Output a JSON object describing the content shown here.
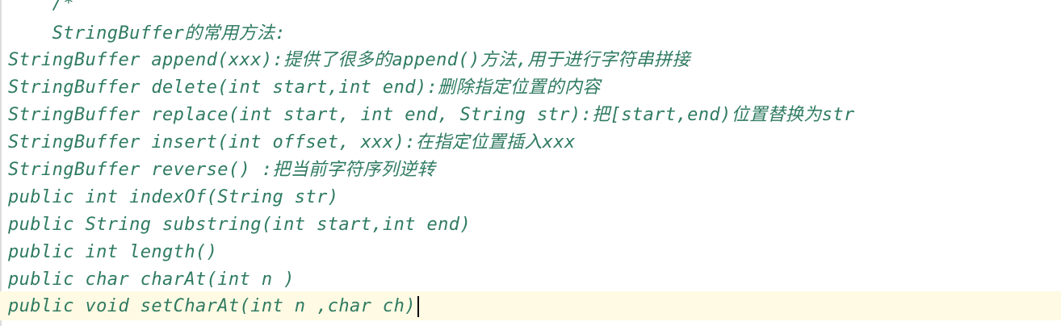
{
  "editor": {
    "lines": [
      "    /*",
      "    StringBuffer的常用方法:",
      "StringBuffer append(xxx):提供了很多的append()方法,用于进行字符串拼接",
      "StringBuffer delete(int start,int end):删除指定位置的内容",
      "StringBuffer replace(int start, int end, String str):把[start,end)位置替换为str",
      "StringBuffer insert(int offset, xxx):在指定位置插入xxx",
      "StringBuffer reverse() :把当前字符序列逆转",
      "public int indexOf(String str)",
      "public String substring(int start,int end)",
      "public int length()",
      "public char charAt(int n )",
      "public void setCharAt(int n ,char ch)"
    ]
  }
}
